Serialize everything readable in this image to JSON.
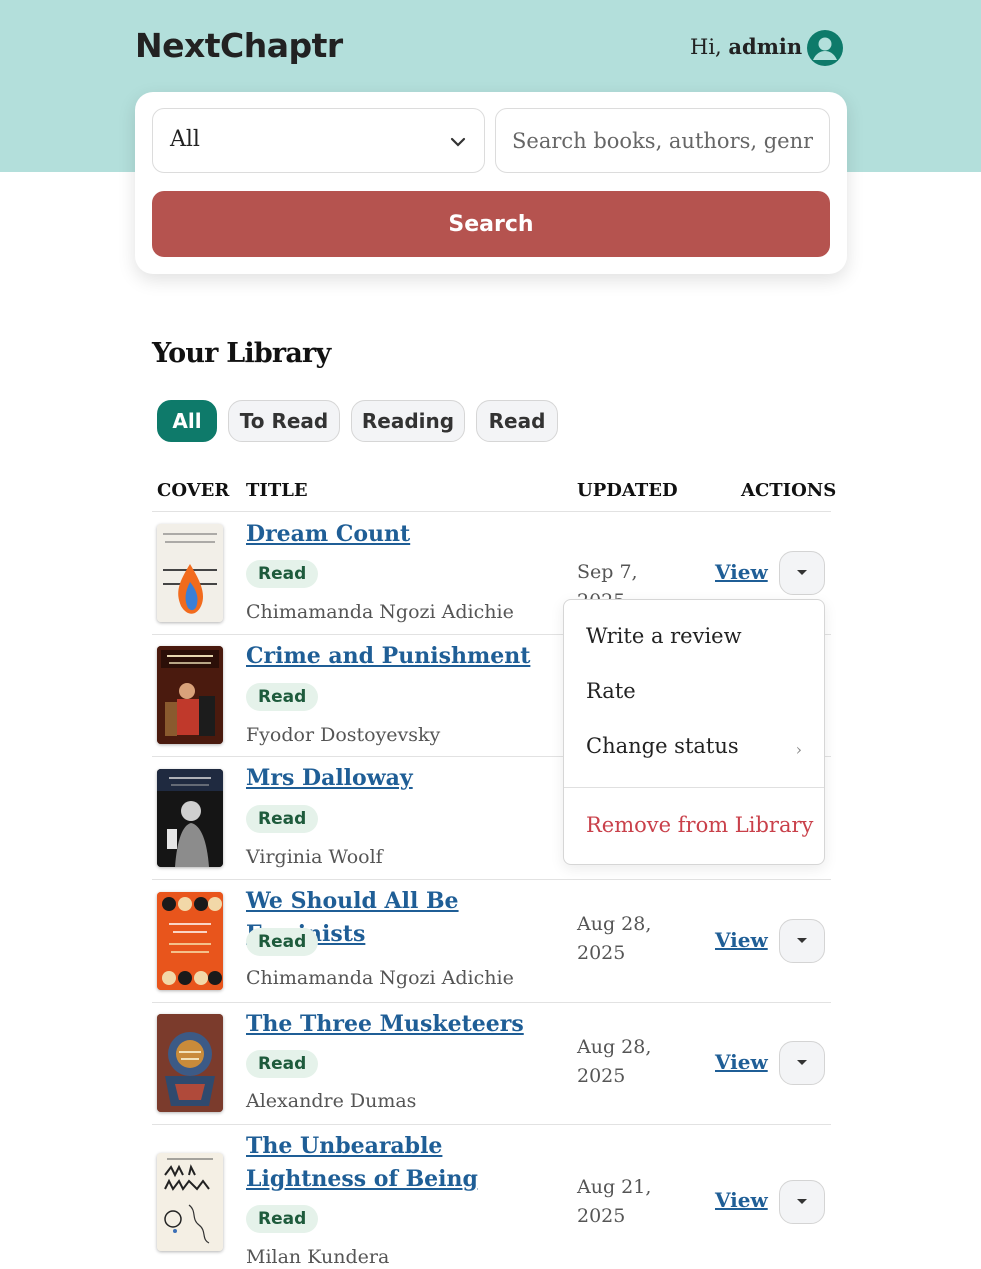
{
  "header": {
    "brand": "NextChaptr",
    "greeting_prefix": "Hi,",
    "username": "admin",
    "avatar_icon": "user-circle-icon"
  },
  "search": {
    "category_value": "All",
    "placeholder": "Search books, authors, genres",
    "button_label": "Search"
  },
  "library": {
    "title": "Your Library",
    "filters": [
      "All",
      "To Read",
      "Reading",
      "Read"
    ],
    "active_filter": "All",
    "columns": [
      "COVER",
      "TITLE",
      "UPDATED",
      "ACTIONS"
    ],
    "view_label": "View",
    "books": [
      {
        "title": "Dream Count",
        "status": "Read",
        "author": "Chimamanda Ngozi Adichie",
        "updated": "Sep 7, 2025"
      },
      {
        "title": "Crime and Punishment",
        "status": "Read",
        "author": "Fyodor Dostoyevsky",
        "updated": ""
      },
      {
        "title": "Mrs Dalloway",
        "status": "Read",
        "author": "Virginia Woolf",
        "updated": ""
      },
      {
        "title": "We Should All Be Feminists",
        "status": "Read",
        "author": "Chimamanda Ngozi Adichie",
        "updated": "Aug 28, 2025"
      },
      {
        "title": "The Three Musketeers",
        "status": "Read",
        "author": "Alexandre Dumas",
        "updated": "Aug 28, 2025"
      },
      {
        "title": "The Unbearable Lightness of Being",
        "status": "Read",
        "author": "Milan Kundera",
        "updated": "Aug 21, 2025"
      }
    ]
  },
  "menu": {
    "write_review": "Write a review",
    "rate": "Rate",
    "change_status": "Change status",
    "remove": "Remove from Library"
  },
  "colors": {
    "header_bg": "#b3dfdb",
    "accent": "#0e7a6a",
    "search_button": "#b5534f",
    "link": "#1f5e96",
    "danger": "#c9404a"
  }
}
